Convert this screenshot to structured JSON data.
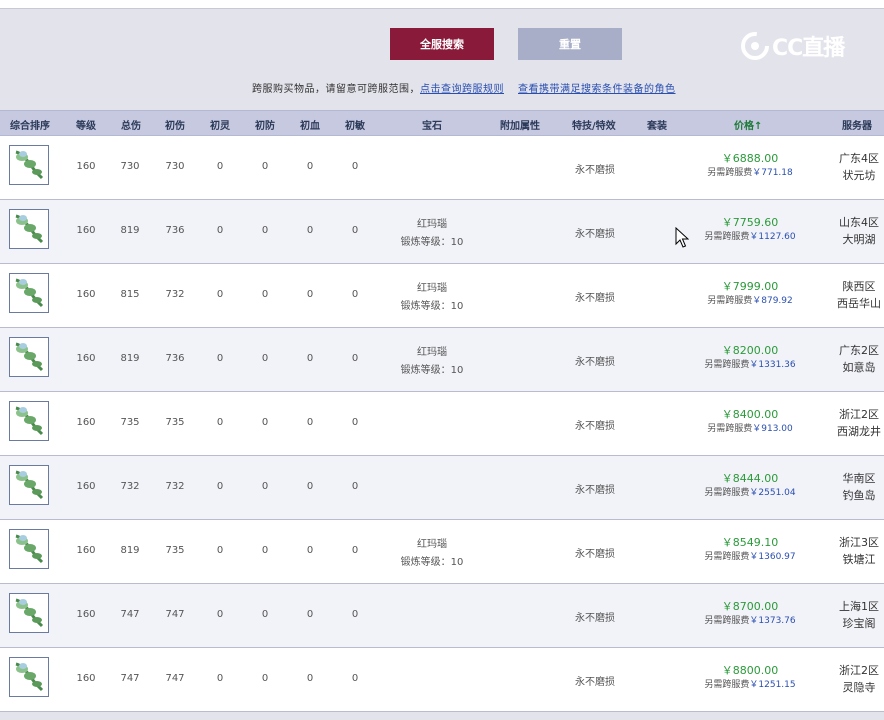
{
  "toolbar": {
    "search_label": "全服搜索",
    "reset_label": "重置"
  },
  "logo": {
    "text": "CC直播"
  },
  "notice": {
    "text": "跨服购买物品，请留意可跨服范围，",
    "link1": "点击查询跨服规则",
    "link2": "查看携带满足搜索条件装备的角色"
  },
  "table": {
    "headers": {
      "rank": "综合排序",
      "level": "等级",
      "total_dmg": "总伤",
      "init_dmg": "初伤",
      "init_spirit": "初灵",
      "init_def": "初防",
      "init_hp": "初血",
      "init_agi": "初敏",
      "gem": "宝石",
      "extra": "附加属性",
      "special": "特技/特效",
      "set": "套装",
      "price": "价格↑",
      "server": "服务器"
    },
    "rows": [
      {
        "level": "160",
        "total": "730",
        "init": "730",
        "spirit": "0",
        "def": "0",
        "hp": "0",
        "agi": "0",
        "gem1": "",
        "gem2": "",
        "special": "永不磨损",
        "price": "￥6888.00",
        "fee_label": "另需跨服费",
        "fee": "￥771.18",
        "server1": "广东4区",
        "server2": "状元坊"
      },
      {
        "level": "160",
        "total": "819",
        "init": "736",
        "spirit": "0",
        "def": "0",
        "hp": "0",
        "agi": "0",
        "gem1": "红玛瑙",
        "gem2": "锻炼等级：10",
        "special": "永不磨损",
        "price": "￥7759.60",
        "fee_label": "另需跨服费",
        "fee": "￥1127.60",
        "server1": "山东4区",
        "server2": "大明湖"
      },
      {
        "level": "160",
        "total": "815",
        "init": "732",
        "spirit": "0",
        "def": "0",
        "hp": "0",
        "agi": "0",
        "gem1": "红玛瑙",
        "gem2": "锻炼等级：10",
        "special": "永不磨损",
        "price": "￥7999.00",
        "fee_label": "另需跨服费",
        "fee": "￥879.92",
        "server1": "陕西区",
        "server2": "西岳华山"
      },
      {
        "level": "160",
        "total": "819",
        "init": "736",
        "spirit": "0",
        "def": "0",
        "hp": "0",
        "agi": "0",
        "gem1": "红玛瑙",
        "gem2": "锻炼等级：10",
        "special": "永不磨损",
        "price": "￥8200.00",
        "fee_label": "另需跨服费",
        "fee": "￥1331.36",
        "server1": "广东2区",
        "server2": "如意岛"
      },
      {
        "level": "160",
        "total": "735",
        "init": "735",
        "spirit": "0",
        "def": "0",
        "hp": "0",
        "agi": "0",
        "gem1": "",
        "gem2": "",
        "special": "永不磨损",
        "price": "￥8400.00",
        "fee_label": "另需跨服费",
        "fee": "￥913.00",
        "server1": "浙江2区",
        "server2": "西湖龙井"
      },
      {
        "level": "160",
        "total": "732",
        "init": "732",
        "spirit": "0",
        "def": "0",
        "hp": "0",
        "agi": "0",
        "gem1": "",
        "gem2": "",
        "special": "永不磨损",
        "price": "￥8444.00",
        "fee_label": "另需跨服费",
        "fee": "￥2551.04",
        "server1": "华南区",
        "server2": "钓鱼岛"
      },
      {
        "level": "160",
        "total": "819",
        "init": "735",
        "spirit": "0",
        "def": "0",
        "hp": "0",
        "agi": "0",
        "gem1": "红玛瑙",
        "gem2": "锻炼等级：10",
        "special": "永不磨损",
        "price": "￥8549.10",
        "fee_label": "另需跨服费",
        "fee": "￥1360.97",
        "server1": "浙江3区",
        "server2": "铁塘江"
      },
      {
        "level": "160",
        "total": "747",
        "init": "747",
        "spirit": "0",
        "def": "0",
        "hp": "0",
        "agi": "0",
        "gem1": "",
        "gem2": "",
        "special": "永不磨损",
        "price": "￥8700.00",
        "fee_label": "另需跨服费",
        "fee": "￥1373.76",
        "server1": "上海1区",
        "server2": "珍宝阁"
      },
      {
        "level": "160",
        "total": "747",
        "init": "747",
        "spirit": "0",
        "def": "0",
        "hp": "0",
        "agi": "0",
        "gem1": "",
        "gem2": "",
        "special": "永不磨损",
        "price": "￥8800.00",
        "fee_label": "另需跨服费",
        "fee": "￥1251.15",
        "server1": "浙江2区",
        "server2": "灵隐寺"
      }
    ]
  },
  "colors": {
    "search_button": "#8a1a3a",
    "reset_button": "#a8adc8",
    "price_green": "#2b9a3a",
    "link_blue": "#2a4fb0"
  },
  "icons": {
    "item": "weapon-leaf-icon",
    "logo": "cc-live-logo-icon",
    "cursor": "mouse-pointer-icon"
  }
}
